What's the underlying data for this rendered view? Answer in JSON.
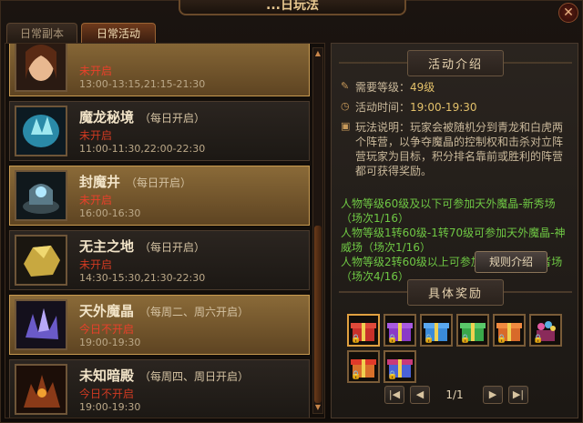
{
  "window": {
    "title": "...日玩法",
    "close_icon": "close-icon"
  },
  "tabs": [
    {
      "label": "日常副本",
      "active": false
    },
    {
      "label": "日常活动",
      "active": true
    }
  ],
  "activities": [
    {
      "name": "",
      "frequency": "",
      "status": "未开启",
      "time": "13:00-13:15,21:15-21:30",
      "icon": "female-portrait-thumb",
      "highlight": true
    },
    {
      "name": "魔龙秘境",
      "frequency": "（每日开启）",
      "status": "未开启",
      "time": "11:00-11:30,22:00-22:30",
      "icon": "crystal-thumb",
      "highlight": false
    },
    {
      "name": "封魔井",
      "frequency": "（每日开启）",
      "status": "未开启",
      "time": "16:00-16:30",
      "icon": "sealed-well-thumb",
      "highlight": true
    },
    {
      "name": "无主之地",
      "frequency": "（每日开启）",
      "status": "未开启",
      "time": "14:30-15:30,21:30-22:30",
      "icon": "gold-rock-thumb",
      "highlight": false
    },
    {
      "name": "天外魔晶",
      "frequency": "（每周二、周六开启）",
      "status": "今日不开启",
      "time": "19:00-19:30",
      "icon": "magic-crystal-thumb",
      "highlight": true
    },
    {
      "name": "未知暗殿",
      "frequency": "（每周四、周日开启）",
      "status": "今日不开启",
      "time": "19:00-19:30",
      "icon": "dark-hall-thumb",
      "highlight": false
    }
  ],
  "detail": {
    "intro_title": "活动介绍",
    "level_label": "需要等级：",
    "level_value": "49级",
    "time_label": "活动时间：",
    "time_value": "19:00-19:30",
    "desc_label": "玩法说明：",
    "desc_text": "玩家会被随机分到青龙和白虎两个阵营，以争夺魔晶的控制权和击杀对立阵营玩家为目标，积分排名靠前或胜利的阵营都可获得奖励。",
    "requirements": [
      "人物等级60级及以下可参加天外魔晶-新秀场（场次1/16）",
      "人物等级1转60级-1转70级可参加天外魔晶-神威场（场次1/16）",
      "人物等级2转60级以上可参加天外魔晶-王者场（场次4/16）"
    ],
    "rules_button": "规则介绍",
    "reward_title": "具体奖励",
    "rewards": [
      {
        "icon": "red-giftbox-icon",
        "color": "#c8302a"
      },
      {
        "icon": "purple-giftbox-icon",
        "color": "#8a3ac8"
      },
      {
        "icon": "blue-giftbox-icon",
        "color": "#3a8ad8"
      },
      {
        "icon": "green-giftbox-icon",
        "color": "#3aa84a"
      },
      {
        "icon": "orange-giftbox-icon",
        "color": "#d86a2a"
      },
      {
        "icon": "flower-giftbox-icon",
        "color": "#b84aa0"
      },
      {
        "icon": "orange-giftbox-icon",
        "color": "#d8702a"
      },
      {
        "icon": "blue-purple-giftbox-icon",
        "color": "#4a62d8"
      }
    ],
    "page_text": "1/1"
  }
}
